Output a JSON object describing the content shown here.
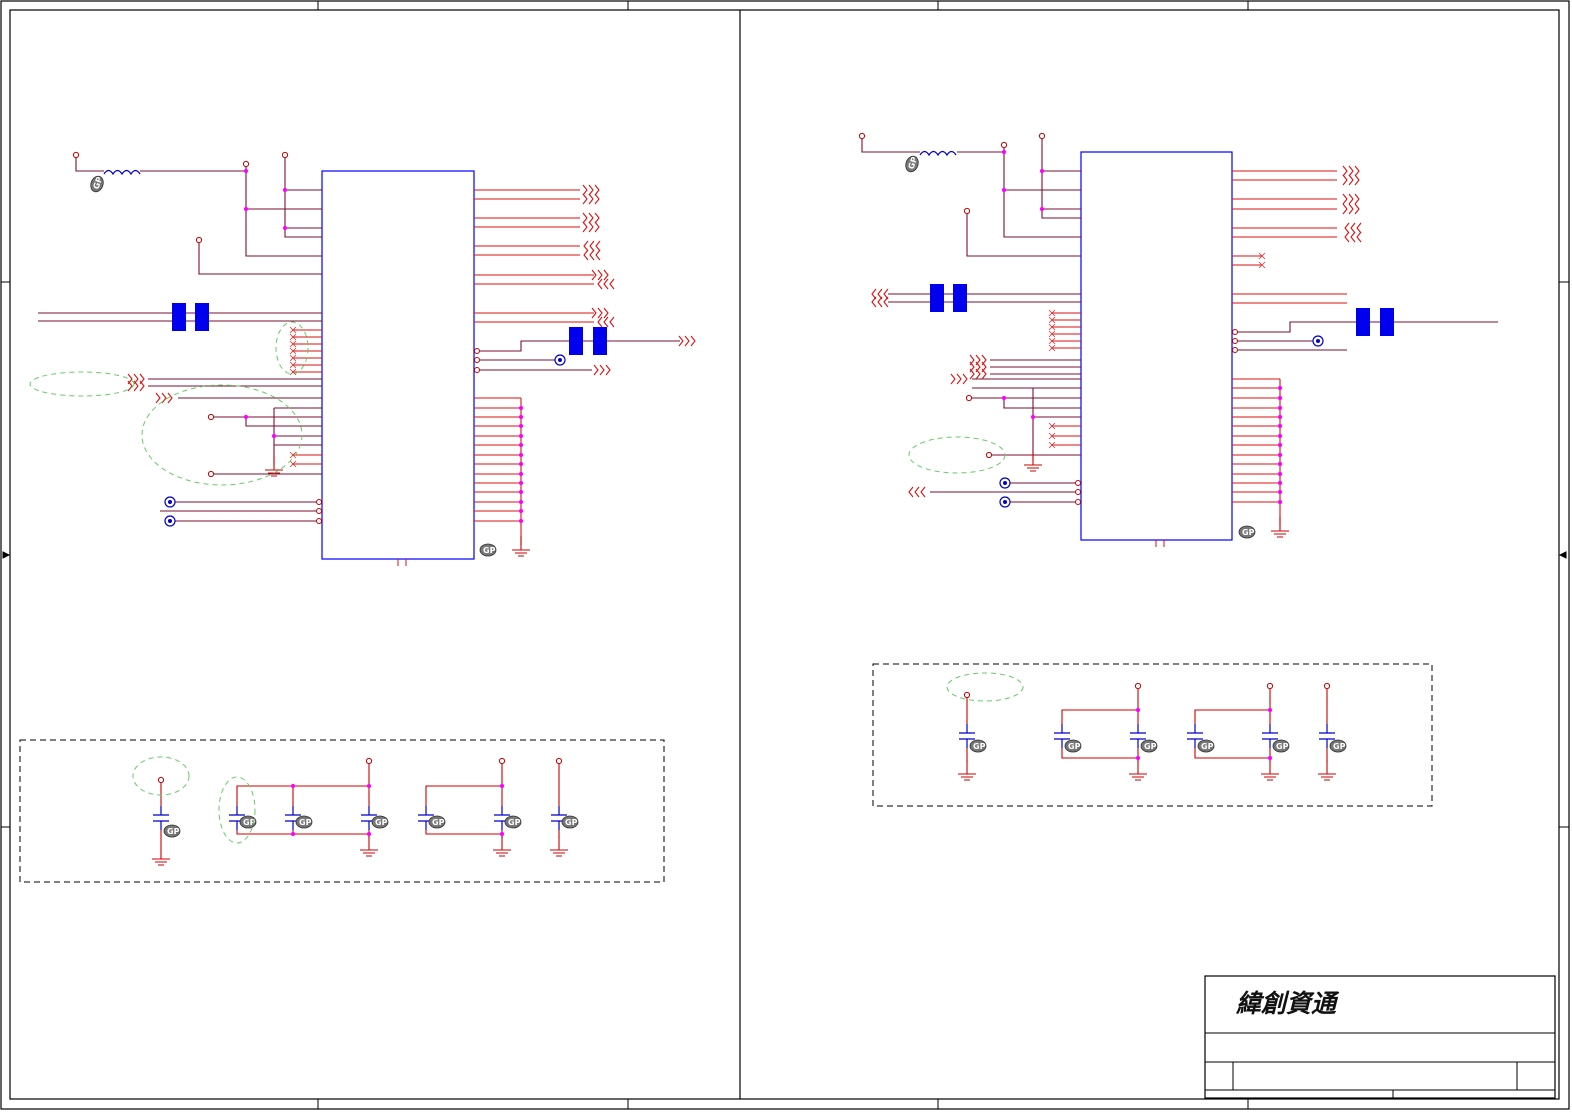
{
  "title_block": {
    "company_name": "緯創資通"
  },
  "colors": {
    "wire": "#cc0000",
    "bus": "#7a1030",
    "junction": "#ff00ff",
    "ic_outline": "#0000ff",
    "component_fill": "#0000ff",
    "annotation": "#55cc55",
    "frame": "#000000"
  },
  "icons": {
    "port": "offpage-connector-icon",
    "ground": "ground-icon",
    "power": "power-pin-icon",
    "inductor": "inductor-icon",
    "capacitor": "capacitor-icon",
    "testpoint": "test-point-icon",
    "grip": "gp-marker-icon",
    "ferrite": "ferrite-bead-icon",
    "noconnect": "no-connect-icon"
  }
}
